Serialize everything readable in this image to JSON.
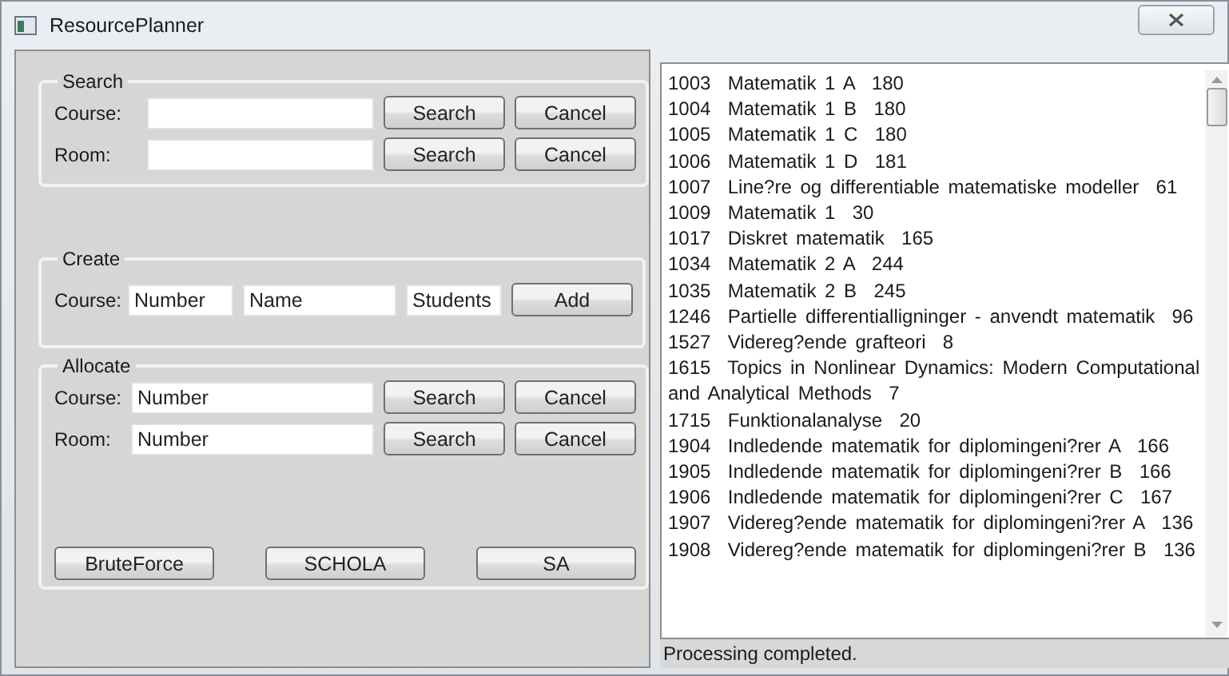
{
  "window": {
    "title": "ResourcePlanner"
  },
  "search": {
    "title": "Search",
    "rows": [
      {
        "label": "Course:",
        "value": "",
        "buttons": [
          "Search",
          "Cancel"
        ]
      },
      {
        "label": "Room:",
        "value": "",
        "buttons": [
          "Search",
          "Cancel"
        ]
      }
    ]
  },
  "create": {
    "title": "Create",
    "label": "Course:",
    "fields": [
      "Number",
      "Name",
      "Students"
    ],
    "button": "Add"
  },
  "allocate": {
    "title": "Allocate",
    "rows": [
      {
        "label": "Course:",
        "value": "Number",
        "buttons": [
          "Search",
          "Cancel"
        ]
      },
      {
        "label": "Room:",
        "value": "Number",
        "buttons": [
          "Search",
          "Cancel"
        ]
      }
    ],
    "algorithms": [
      "BruteForce",
      "SCHOLA",
      "SA"
    ]
  },
  "output": {
    "lines": [
      "1003  Matematik 1 A  180",
      "1004  Matematik 1 B  180",
      "1005  Matematik 1 C  180",
      "1006  Matematik 1 D  181",
      "1007  Line?re og differentiable matematiske modeller  61",
      "1009  Matematik 1  30",
      "1017  Diskret matematik  165",
      "1034  Matematik 2 A  244",
      "1035  Matematik 2 B  245",
      "1246  Partielle differentialligninger - anvendt matematik  96",
      "1527  Videreg?ende grafteori  8",
      "1615  Topics in Nonlinear Dynamics: Modern Computational and Analytical Methods  7",
      "1715  Funktionalanalyse  20",
      "1904  Indledende matematik for diplomingeni?rer A  166",
      "1905  Indledende matematik for diplomingeni?rer B  166",
      "1906  Indledende matematik for diplomingeni?rer C  167",
      "1907  Videreg?ende matematik for diplomingeni?rer A  136",
      "1908  Videreg?ende matematik for diplomingeni?rer B  136"
    ]
  },
  "status_bar": "Processing completed."
}
